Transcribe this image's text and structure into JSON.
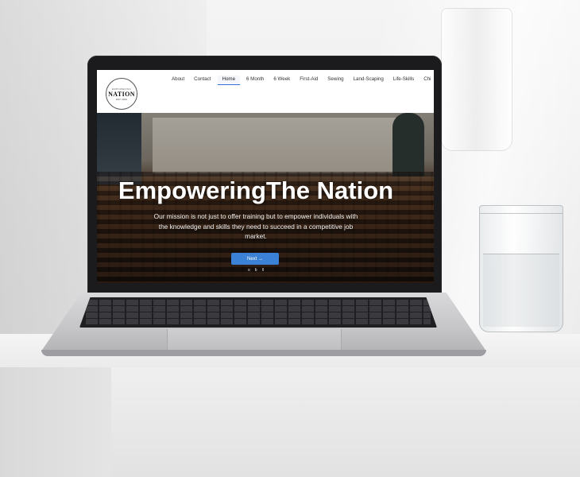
{
  "site": {
    "logo": {
      "tagline": "EMPOWERING",
      "name": "NATION",
      "est": "EST. 2023"
    },
    "nav": [
      {
        "label": "About",
        "active": false
      },
      {
        "label": "Contact",
        "active": false
      },
      {
        "label": "Home",
        "active": true
      },
      {
        "label": "6 Month",
        "active": false
      },
      {
        "label": "6 Week",
        "active": false
      },
      {
        "label": "First-Aid",
        "active": false
      },
      {
        "label": "Sewing",
        "active": false
      },
      {
        "label": "Land-Scaping",
        "active": false
      },
      {
        "label": "Life-Skills",
        "active": false
      },
      {
        "label": "Chi",
        "active": false
      }
    ],
    "hero": {
      "title": "EmpoweringThe Nation",
      "text": "Our mission is not just to offer training but to empower individuals with the knowledge and skills they need to succeed in a competitive job market.",
      "button_label": "Next →",
      "carousel_dots": [
        "o",
        "ɓ",
        "¢"
      ]
    }
  },
  "colors": {
    "accent": "#3b82d6",
    "nav_active": "#3b6fd6"
  }
}
